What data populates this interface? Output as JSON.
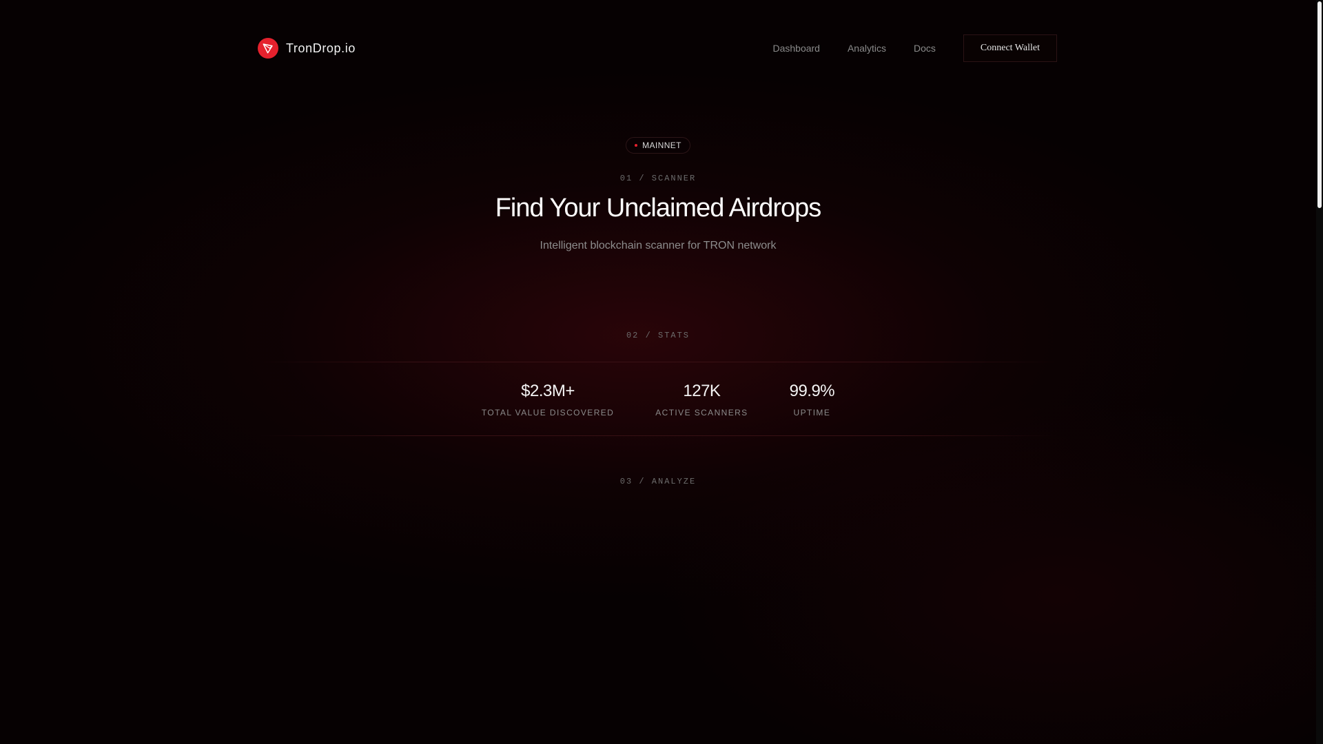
{
  "brand": {
    "name": "TronDrop.io",
    "logo_icon": "tron-logo-icon",
    "accent_color": "#e5212d"
  },
  "nav": {
    "links": [
      {
        "label": "Dashboard"
      },
      {
        "label": "Analytics"
      },
      {
        "label": "Docs"
      }
    ],
    "connect_label": "Connect Wallet"
  },
  "hero": {
    "badge": "MAINNET",
    "section_label": "01 / SCANNER",
    "title": "Find Your Unclaimed Airdrops",
    "subtitle": "Intelligent blockchain scanner for TRON network"
  },
  "stats": {
    "section_label": "02 / STATS",
    "items": [
      {
        "value": "$2.3M+",
        "label": "TOTAL VALUE DISCOVERED"
      },
      {
        "value": "127K",
        "label": "ACTIVE SCANNERS"
      },
      {
        "value": "99.9%",
        "label": "UPTIME"
      }
    ]
  },
  "analyze": {
    "section_label": "03 / ANALYZE"
  }
}
